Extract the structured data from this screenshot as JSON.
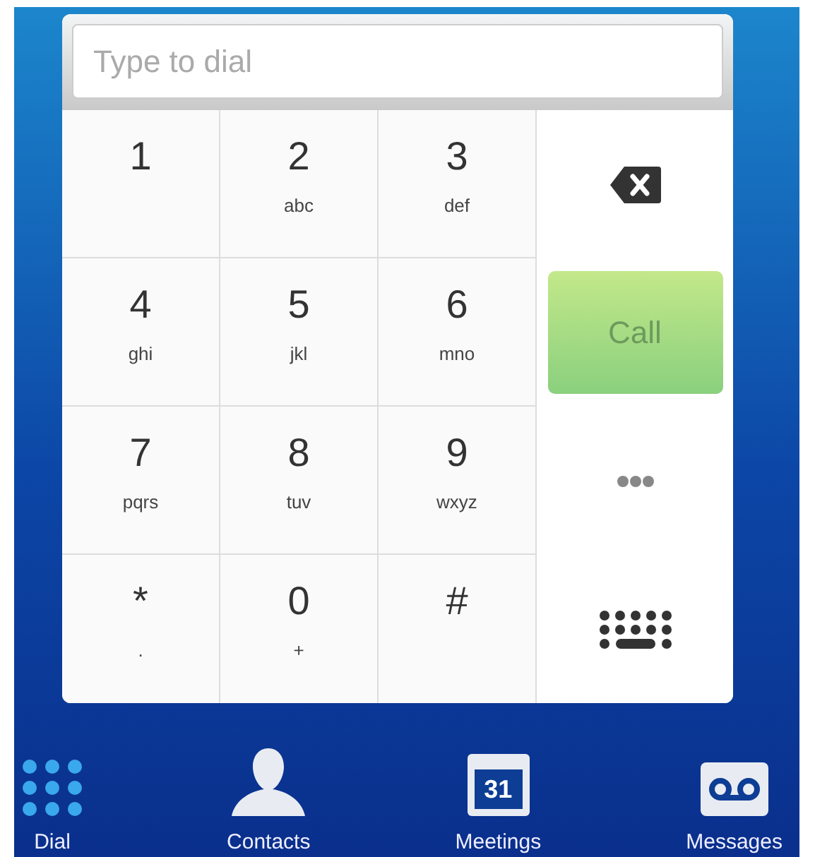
{
  "dial_field": {
    "placeholder": "Type to dial"
  },
  "keys": [
    {
      "digit": "1"
    },
    {
      "digit": "2",
      "letters": "abc"
    },
    {
      "digit": "3",
      "letters": "def"
    },
    {
      "digit": "4",
      "letters": "ghi"
    },
    {
      "digit": "5",
      "letters": "jkl"
    },
    {
      "digit": "6",
      "letters": "mno"
    },
    {
      "digit": "7",
      "letters": "pqrs"
    },
    {
      "digit": "8",
      "letters": "tuv"
    },
    {
      "digit": "9",
      "letters": "wxyz"
    },
    {
      "digit": "*",
      "letters": "."
    },
    {
      "digit": "0",
      "letters": "+"
    },
    {
      "digit": "#"
    }
  ],
  "actions": [
    {
      "kind": "backspace"
    },
    {
      "kind": "call",
      "label": "Call",
      "disabled": true
    },
    {
      "kind": "more"
    },
    {
      "kind": "keyboard"
    }
  ],
  "nav": [
    {
      "kind": "dial",
      "label": "Dial",
      "selected": true
    },
    {
      "kind": "contacts",
      "label": "Contacts",
      "selected": false
    },
    {
      "kind": "meetings",
      "label": "Meetings",
      "icon_text": "31",
      "selected": false
    },
    {
      "kind": "messages",
      "label": "Messages",
      "selected": false
    }
  ]
}
